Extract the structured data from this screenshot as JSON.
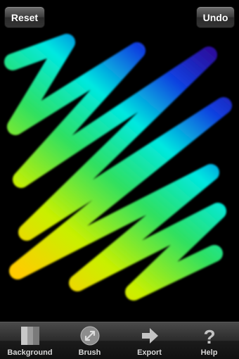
{
  "canvas": {
    "stroke_gradient": [
      "#ffcc00",
      "#c8f000",
      "#30e060",
      "#00e8e0",
      "#1040e0",
      "#2a10a0"
    ]
  },
  "top_bar": {
    "reset_label": "Reset",
    "undo_label": "Undo"
  },
  "toolbar": {
    "items": [
      {
        "label": "Background",
        "icon": "background-icon"
      },
      {
        "label": "Brush",
        "icon": "brush-icon"
      },
      {
        "label": "Export",
        "icon": "export-arrow-icon"
      },
      {
        "label": "Help",
        "icon": "help-question-icon"
      }
    ]
  }
}
